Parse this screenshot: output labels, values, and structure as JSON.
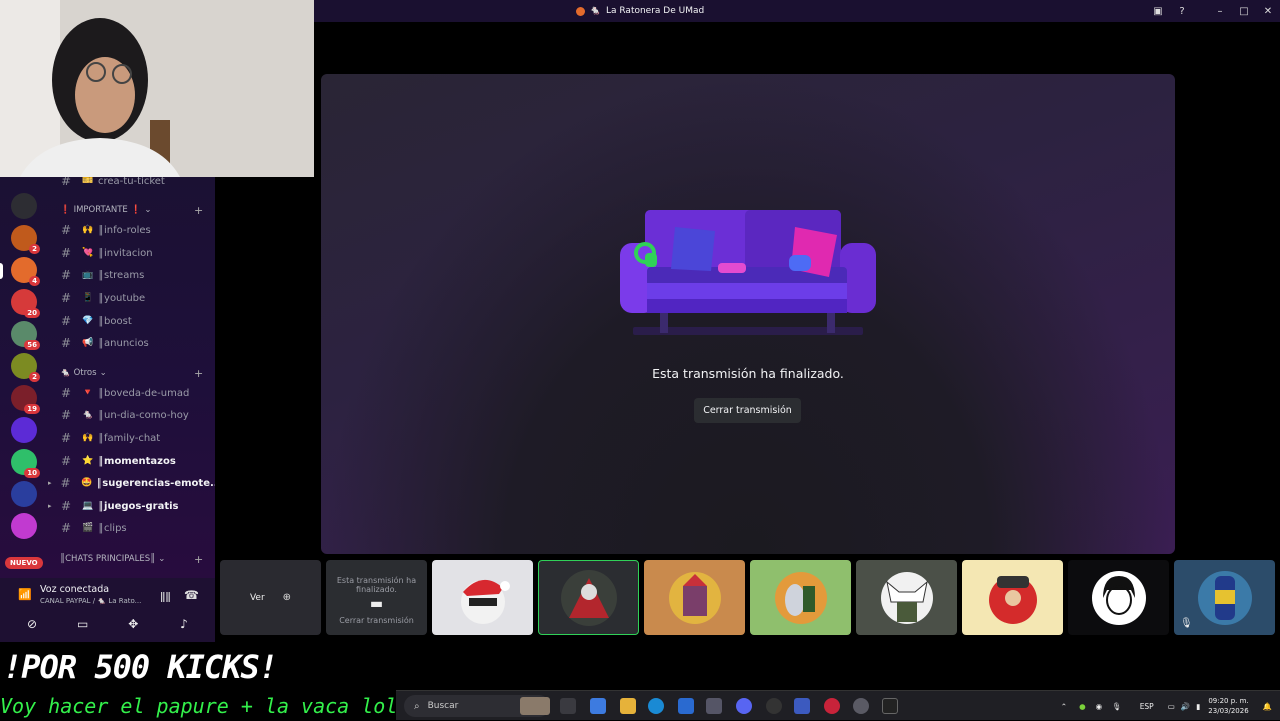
{
  "window": {
    "title": "La Ratonera De UMad"
  },
  "webcam": {
    "label": "webcam"
  },
  "sidebar": {
    "top_channel": "crea-tu-ticket",
    "categories": [
      {
        "label": "IMPORTANTE",
        "prefix": "❗",
        "suffix": "❗"
      },
      {
        "label": "Otros"
      },
      {
        "label": "║CHATS PRINCIPALES║"
      }
    ],
    "channels_important": [
      {
        "emoji": "🙌",
        "label": "║info-roles"
      },
      {
        "emoji": "💘",
        "label": "║invitacion"
      },
      {
        "emoji": "📺",
        "label": "║streams"
      },
      {
        "emoji": "📱",
        "label": "║youtube"
      },
      {
        "emoji": "💎",
        "label": "║boost"
      },
      {
        "emoji": "📢",
        "label": "║anuncios"
      }
    ],
    "channels_otros": [
      {
        "emoji": "🔻",
        "label": "║boveda-de-umad"
      },
      {
        "emoji": "🐁",
        "label": "║un-dia-como-hoy"
      },
      {
        "emoji": "🙌",
        "label": "║family-chat"
      },
      {
        "emoji": "⭐",
        "label": "║momentazos"
      },
      {
        "emoji": "🤩",
        "label": "║sugerencias-emote..."
      },
      {
        "emoji": "💻",
        "label": "║juegos-gratis"
      },
      {
        "emoji": "🎬",
        "label": "║clips"
      }
    ],
    "server_badges": [
      "2",
      "4",
      "20",
      "56",
      "2",
      "19",
      "10"
    ],
    "nuevo_badge": "NUEVO"
  },
  "voice": {
    "status": "Voz conectada",
    "channel": "CANAL PAYPAL / 🐁 La Rato..."
  },
  "stream": {
    "ended_text": "Esta transmisión ha finalizado.",
    "close_button": "Cerrar transmisión"
  },
  "tiles": {
    "tile1_label": "Ver",
    "tile2_text": "Esta transmisión ha finalizado.",
    "tile2_button": "Cerrar transmisión"
  },
  "overlay": {
    "banner": "!POR 500 KICKS!",
    "marquee": "Voy hacer el papure + la vaca lola"
  },
  "taskbar": {
    "search_placeholder": "Buscar",
    "language": "ESP",
    "time": "09:20 p. m.",
    "date": "23/03/2026"
  },
  "colors": {
    "accent": "#5865f2",
    "sidebar": "#1e1032",
    "marquee_green": "#33f04b"
  }
}
